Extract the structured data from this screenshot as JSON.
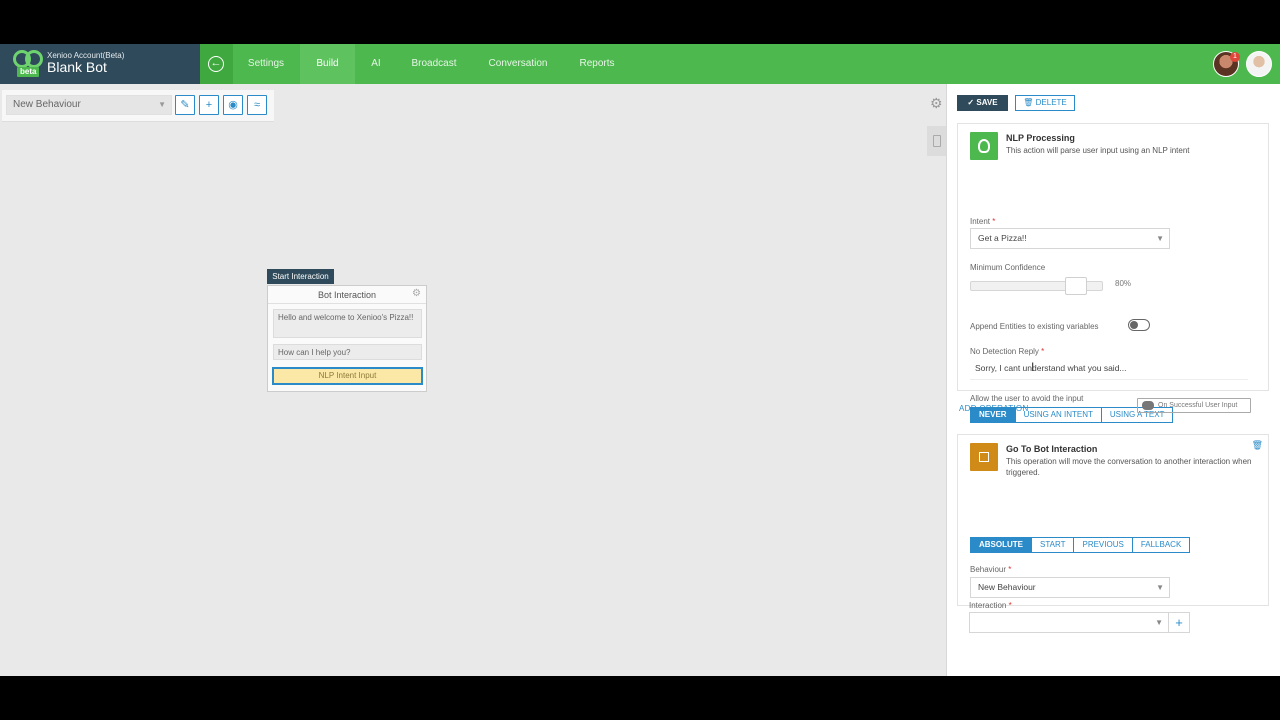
{
  "header": {
    "account": "Xenioo Account(Beta)",
    "bot_name": "Blank Bot",
    "badge": "beta",
    "notification_count": "1",
    "nav": [
      {
        "label": "Settings"
      },
      {
        "label": "Build"
      },
      {
        "label": "AI"
      },
      {
        "label": "Broadcast"
      },
      {
        "label": "Conversation"
      },
      {
        "label": "Reports"
      }
    ],
    "active_nav": "Build"
  },
  "canvas": {
    "behaviour_select": "New Behaviour",
    "tools": [
      "pencil-icon",
      "plus-icon",
      "eye-icon",
      "wifi-icon"
    ],
    "node": {
      "start_label": "Start Interaction",
      "title": "Bot Interaction",
      "messages": [
        "Hello and welcome to Xenioo's Pizza!!",
        "How can I help you?"
      ],
      "input": "NLP Intent Input"
    }
  },
  "panel": {
    "save_label": "SAVE",
    "delete_label": "DELETE",
    "nlp": {
      "title": "NLP Processing",
      "description": "This action will parse user input using an NLP intent",
      "intent_label": "Intent",
      "intent_value": "Get a Pizza!!",
      "confidence_label": "Minimum Confidence",
      "confidence_value": "80%",
      "confidence_fraction": 0.8,
      "append_label": "Append Entities to existing variables",
      "append_enabled": false,
      "reply_label": "No Detection Reply",
      "reply_value": "Sorry, I cant understand what you said...",
      "avoid_label": "Allow the user to avoid the input",
      "avoid_options": [
        "NEVER",
        "USING AN INTENT",
        "USING A TEXT"
      ],
      "avoid_selected": "NEVER",
      "add_operation": "ADD OPERATION",
      "on_success": "On Successful User Input"
    },
    "goto": {
      "title": "Go To Bot Interaction",
      "description": "This operation will move the conversation to another interaction when triggered.",
      "mode_options": [
        "ABSOLUTE",
        "START",
        "PREVIOUS",
        "FALLBACK"
      ],
      "mode_selected": "ABSOLUTE",
      "behaviour_label": "Behaviour",
      "behaviour_value": "New Behaviour",
      "interaction_label": "Interaction",
      "interaction_value": ""
    }
  },
  "colors": {
    "brand_green": "#4cb84d",
    "header_dark": "#2f4a5a",
    "accent_blue": "#2a8bc8",
    "node_input": "#fbe8a6",
    "goto_icon": "#d08a18"
  }
}
